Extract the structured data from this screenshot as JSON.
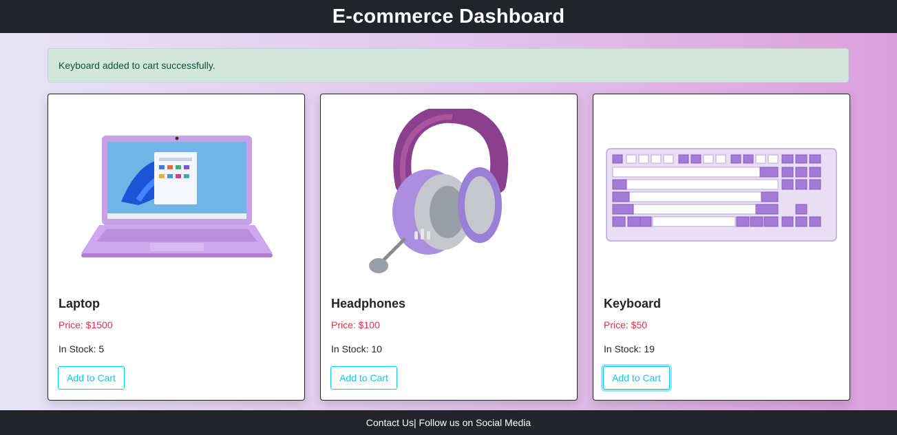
{
  "header": {
    "title": "E-commerce Dashboard"
  },
  "alert": {
    "message": "Keyboard added to cart successfully."
  },
  "products": [
    {
      "name": "Laptop",
      "price": "Price: $1500",
      "stock": "In Stock: 5",
      "button": "Add to Cart",
      "image_icon": "laptop-icon"
    },
    {
      "name": "Headphones",
      "price": "Price: $100",
      "stock": "In Stock: 10",
      "button": "Add to Cart",
      "image_icon": "headphones-icon"
    },
    {
      "name": "Keyboard",
      "price": "Price: $50",
      "stock": "In Stock: 19",
      "button": "Add to Cart",
      "image_icon": "keyboard-icon"
    }
  ],
  "footer": {
    "text": "Contact Us| Follow us on Social Media"
  },
  "colors": {
    "header_bg": "#212529",
    "price": "#dc3545",
    "button": "#0dcaf0",
    "alert_bg": "#d1e7dd",
    "product_accent": "#b57fd6"
  }
}
